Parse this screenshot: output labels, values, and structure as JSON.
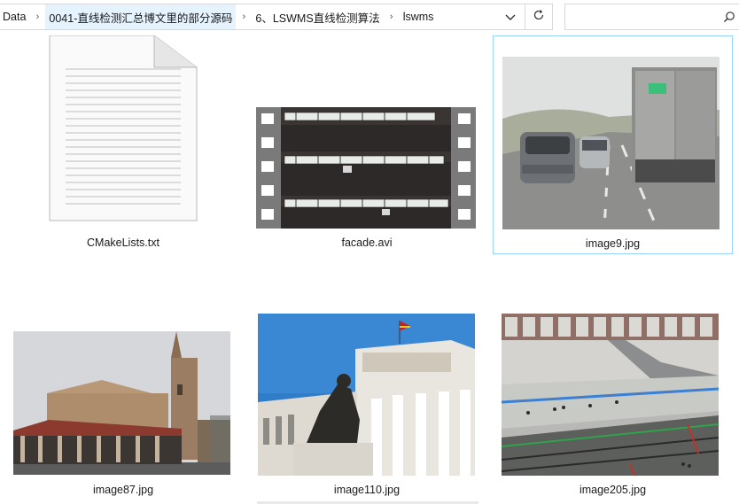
{
  "breadcrumb": {
    "items": [
      "Data",
      "0041-直线检测汇总博文里的部分源码",
      "6、LSWMS直线检测算法",
      "lswms"
    ],
    "separator": "›"
  },
  "search": {
    "placeholder": "",
    "value": ""
  },
  "icons": {
    "dropdown": "chevron-down-icon",
    "refresh": "refresh-icon",
    "search": "search-icon",
    "document": "text-file-icon",
    "video": "video-file-icon"
  },
  "files": [
    {
      "name": "CMakeLists.txt",
      "type": "text"
    },
    {
      "name": "facade.avi",
      "type": "video"
    },
    {
      "name": "image9.jpg",
      "type": "image",
      "selected": true
    },
    {
      "name": "image87.jpg",
      "type": "image"
    },
    {
      "name": "image110.jpg",
      "type": "image"
    },
    {
      "name": "image205.jpg",
      "type": "image"
    }
  ],
  "colors": {
    "selection_border": "#99d1ff",
    "crumb_highlight": "#e5f3ff"
  }
}
